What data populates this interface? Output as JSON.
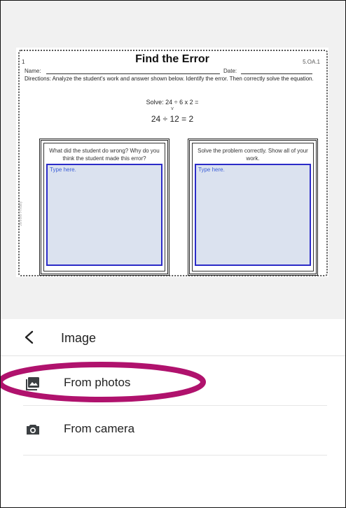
{
  "worksheet": {
    "page_number": "1",
    "title": "Find the Error",
    "code": "5.OA.1",
    "name_label": "Name:",
    "date_label": "Date:",
    "directions": "Directions: Analyze the student's work and answer shown below. Identify the error. Then correctly solve the equation.",
    "solve": "Solve: 24 ÷ 6 x 2 =",
    "mark": "v",
    "student_work": "24 ÷ 12 = 2",
    "left_question": "What did the student do wrong? Why do you think the student made this error?",
    "right_question": "Solve the problem correctly. Show all of your work.",
    "left_placeholder": "Type here.",
    "right_placeholder": "Type here.",
    "credit": "Jennifer Findley"
  },
  "sheet": {
    "title": "Image",
    "options": [
      {
        "label": "From photos",
        "icon": "photo-icon"
      },
      {
        "label": "From camera",
        "icon": "camera-icon"
      }
    ]
  },
  "colors": {
    "highlight": "#b0126d",
    "answer_box": "#dbe2ef",
    "answer_border": "#2b2bc8"
  }
}
